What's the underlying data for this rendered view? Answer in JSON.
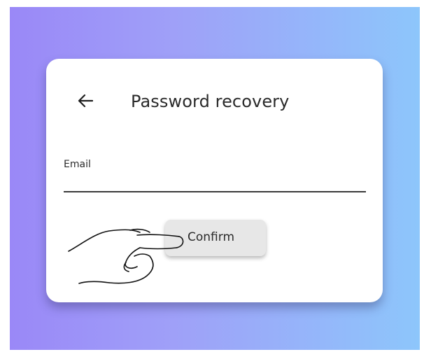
{
  "dialog": {
    "title": "Password recovery",
    "back_icon": "arrow-left-icon"
  },
  "email_field": {
    "label": "Email",
    "value": ""
  },
  "confirm_button": {
    "label": "Confirm"
  },
  "overlay": {
    "pointer_icon": "hand-pointer-icon"
  },
  "colors": {
    "gradient_start": "#9a88f7",
    "gradient_end": "#8dc6fb",
    "card": "#ffffff",
    "button": "#e7e7e7",
    "text": "#2a2a2a"
  }
}
